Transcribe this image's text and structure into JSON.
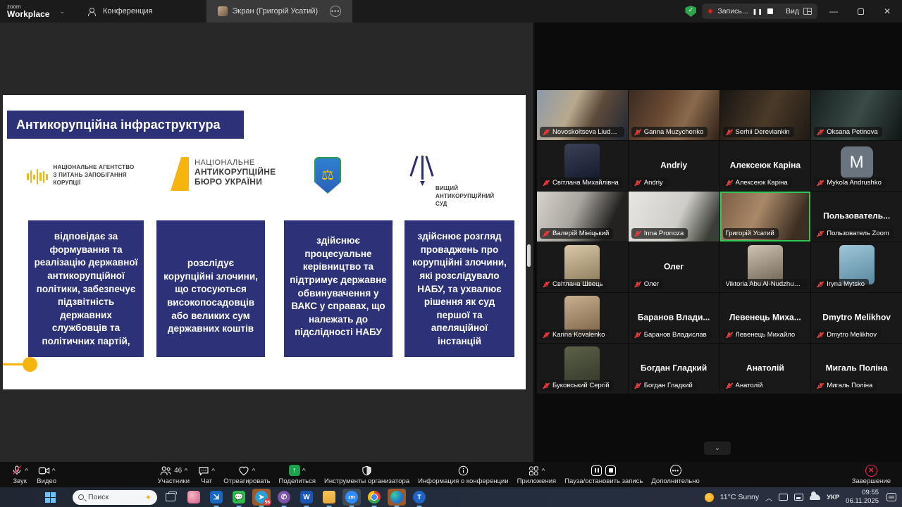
{
  "window": {
    "brand_top": "zoom",
    "brand_bottom": "Workplace",
    "tab_meeting": "Конференция",
    "tab_screen": "Экран (Григорій Усатий)",
    "recording_label": "Запись...",
    "view_label": "Вид"
  },
  "slide": {
    "title": "Антикорупційна інфраструктура",
    "colors": {
      "navy": "#2d3178",
      "yellow": "#f6b40e"
    },
    "logos": [
      {
        "name": "НАЗК",
        "lines": [
          "НАЦІОНАЛЬНЕ АГЕНТСТВО",
          "З ПИТАНЬ ЗАПОБІГАННЯ",
          "КОРУПЦІЇ"
        ]
      },
      {
        "name": "НАБУ",
        "lines": [
          "НАЦІОНАЛЬНЕ",
          "АНТИКОРУПЦІЙНЕ",
          "БЮРО УКРАЇНИ"
        ]
      },
      {
        "name": "САП",
        "lines": []
      },
      {
        "name": "ВАКС",
        "lines": [
          "ВИЩИЙ",
          "АНТИКОРУПЦІЙНИЙ",
          "СУД"
        ]
      }
    ],
    "boxes": [
      "відповідає за формування та реалізацію державної антикорупційної політики, забезпечує підзвітність державних службовців та політичних партій,",
      "розслідує корупційні злочини, що стосуються високопосадовців або великих сум державних коштів",
      "здійснює процесуальне керівництво та підтримує державне обвинувачення у ВАКС у справах, що належать до підслідності НАБУ",
      "здійснює розгляд проваджень про корупційні злочини, які розслідувало НАБУ, та ухвалює рішення як суд першої та апеляційної інстанцій"
    ]
  },
  "participants": {
    "tiles": [
      {
        "label": "Novoskoltseva Liudmyla",
        "type": "video",
        "muted": true
      },
      {
        "label": "Ganna Muzychenko",
        "type": "video",
        "muted": true
      },
      {
        "label": "Serhii Dereviankin",
        "type": "video",
        "muted": true
      },
      {
        "label": "Oksana Petinova",
        "type": "video",
        "muted": true
      },
      {
        "label": "Світлана Михайлівна",
        "type": "photo",
        "muted": true
      },
      {
        "label": "Andriy",
        "display": "Andriy",
        "type": "name",
        "muted": true
      },
      {
        "label": "Алексеюк Каріна",
        "display": "Алексеюк Каріна",
        "type": "name",
        "muted": true
      },
      {
        "label": "Mykola Andrushko",
        "display": "M",
        "type": "letter",
        "muted": true
      },
      {
        "label": "Валерій Мініцький",
        "type": "video",
        "muted": true
      },
      {
        "label": "Inna Pronoza",
        "type": "video",
        "muted": true
      },
      {
        "label": "Григорій Усатий",
        "type": "video",
        "muted": false,
        "active": true
      },
      {
        "label": "Пользователь Zoom",
        "display": "Пользователь...",
        "type": "name",
        "muted": true
      },
      {
        "label": "Світлана Швець",
        "type": "photo",
        "muted": true
      },
      {
        "label": "Олег",
        "display": "Олег",
        "type": "name",
        "muted": true
      },
      {
        "label": "Viktoria Abu Al-Nudzhum Al-...",
        "type": "photo",
        "muted": false
      },
      {
        "label": "Iryna Mytsko",
        "type": "photo",
        "muted": true
      },
      {
        "label": "Karina Kovalenko",
        "type": "photo",
        "muted": true
      },
      {
        "label": "Баранов Владислав",
        "display": "Баранов Влади...",
        "type": "name",
        "muted": true
      },
      {
        "label": "Левенець Михайло",
        "display": "Левенець Миха...",
        "type": "name",
        "muted": true
      },
      {
        "label": "Dmytro Melikhov",
        "display": "Dmytro Melikhov",
        "type": "name",
        "muted": true
      },
      {
        "label": "Буковський Сергій",
        "type": "photo",
        "muted": true
      },
      {
        "label": "Богдан Гладкий",
        "display": "Богдан Гладкий",
        "type": "name",
        "muted": true
      },
      {
        "label": "Анатолій",
        "display": "Анатолій",
        "type": "name",
        "muted": true
      },
      {
        "label": "Мигаль Поліна",
        "display": "Мигаль Поліна",
        "type": "name",
        "muted": true
      }
    ]
  },
  "toolbar": {
    "audio": "Звук",
    "video": "Видео",
    "participants": "Участники",
    "participants_count": "46",
    "chat": "Чат",
    "react": "Отреагировать",
    "share": "Поделиться",
    "host_tools": "Инструменты организатора",
    "meeting_info": "Информация о конференции",
    "apps": "Приложения",
    "pause_stop": "Пауза/остановить запись",
    "more": "Дополнительно",
    "end": "Завершение"
  },
  "taskbar": {
    "search_placeholder": "Поиск",
    "telegram_badge": "56",
    "weather": "11°C  Sunny",
    "language": "УКР",
    "time": "09:55",
    "date": "06.11.2025"
  }
}
